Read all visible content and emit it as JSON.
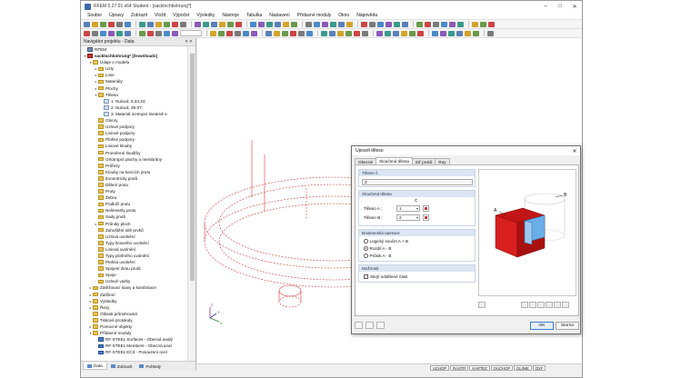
{
  "window": {
    "title": "RFEM 5.27.01 x64 Student - [sacklochbohrung*]"
  },
  "menu": [
    "Soubor",
    "Úpravy",
    "Zobrazit",
    "Vložit",
    "Výpočet",
    "Výsledky",
    "Nástroje",
    "Tabulka",
    "Nastavení",
    "Přídavné moduly",
    "Okno",
    "Nápověda"
  ],
  "navigator": {
    "title": "Navigátor projektu - Data",
    "tree": [
      {
        "level": 0,
        "expander": "",
        "icon": "proj",
        "label": "RFEM"
      },
      {
        "level": 0,
        "expander": "▾",
        "icon": "root",
        "label": "sacklochbohrung* [Downloads]",
        "bold": true
      },
      {
        "level": 1,
        "expander": "▾",
        "icon": "folder",
        "label": "Údaje o modelu"
      },
      {
        "level": 2,
        "expander": "▸",
        "icon": "folder",
        "label": "Uzly"
      },
      {
        "level": 2,
        "expander": "▸",
        "icon": "folder",
        "label": "Linie"
      },
      {
        "level": 2,
        "expander": "▸",
        "icon": "folder",
        "label": "Materiály"
      },
      {
        "level": 2,
        "expander": "▸",
        "icon": "folder",
        "label": "Plochy"
      },
      {
        "level": 2,
        "expander": "▾",
        "icon": "folder",
        "label": "Tělesa"
      },
      {
        "level": 3,
        "expander": "",
        "icon": "item",
        "label": "1: Nulová; 6,33,34;"
      },
      {
        "level": 3,
        "expander": "",
        "icon": "item",
        "label": "2: Nulová; 35-37;"
      },
      {
        "level": 3,
        "expander": "",
        "icon": "item",
        "label": "3: Materiál izotropní lineárně e"
      },
      {
        "level": 2,
        "expander": "",
        "icon": "folder",
        "label": "Otvory"
      },
      {
        "level": 2,
        "expander": "",
        "icon": "folder",
        "label": "Uzlové podpory"
      },
      {
        "level": 2,
        "expander": "",
        "icon": "folder",
        "label": "Liniové podpory"
      },
      {
        "level": 2,
        "expander": "",
        "icon": "folder",
        "label": "Plošné podpory"
      },
      {
        "level": 2,
        "expander": "",
        "icon": "folder",
        "label": "Liniové klouby"
      },
      {
        "level": 2,
        "expander": "",
        "icon": "folder",
        "label": "Proměnné tloušťky"
      },
      {
        "level": 2,
        "expander": "",
        "icon": "folder",
        "label": "Ortotropní plochy a membrány"
      },
      {
        "level": 2,
        "expander": "",
        "icon": "folder",
        "label": "Průřezy"
      },
      {
        "level": 2,
        "expander": "",
        "icon": "folder",
        "label": "Klouby na koncích prutu"
      },
      {
        "level": 2,
        "expander": "",
        "icon": "folder",
        "label": "Excentricity prutů"
      },
      {
        "level": 2,
        "expander": "",
        "icon": "folder",
        "label": "Dělení prutu"
      },
      {
        "level": 2,
        "expander": "",
        "icon": "folder",
        "label": "Pruty"
      },
      {
        "level": 2,
        "expander": "",
        "icon": "folder",
        "label": "Žebra"
      },
      {
        "level": 2,
        "expander": "",
        "icon": "folder",
        "label": "Podloží prutu"
      },
      {
        "level": 2,
        "expander": "",
        "icon": "folder",
        "label": "Nelinearity prutu"
      },
      {
        "level": 2,
        "expander": "",
        "icon": "folder",
        "label": "Sady prutů"
      },
      {
        "level": 2,
        "expander": "▸",
        "icon": "folder",
        "label": "Průniky ploch"
      },
      {
        "level": 2,
        "expander": "",
        "icon": "folder",
        "label": "Zahuštění sítě prvků"
      },
      {
        "level": 2,
        "expander": "",
        "icon": "folder",
        "label": "Uzlová uvolnění"
      },
      {
        "level": 2,
        "expander": "",
        "icon": "folder",
        "label": "Typy liniového uvolnění"
      },
      {
        "level": 2,
        "expander": "",
        "icon": "folder",
        "label": "Liniová uvolnění"
      },
      {
        "level": 2,
        "expander": "",
        "icon": "folder",
        "label": "Typy plošného uvolnění"
      },
      {
        "level": 2,
        "expander": "",
        "icon": "folder",
        "label": "Plošná uvolnění"
      },
      {
        "level": 2,
        "expander": "",
        "icon": "folder",
        "label": "Spojení dvou prutů"
      },
      {
        "level": 2,
        "expander": "",
        "icon": "folder",
        "label": "Spoje"
      },
      {
        "level": 2,
        "expander": "",
        "icon": "folder",
        "label": "Uzlové vazby"
      },
      {
        "level": 1,
        "expander": "▸",
        "icon": "folder",
        "label": "Zatěžovací stavy a kombinace"
      },
      {
        "level": 1,
        "expander": "▸",
        "icon": "folder",
        "label": "Zatížení"
      },
      {
        "level": 1,
        "expander": "▸",
        "icon": "folder",
        "label": "Výsledky"
      },
      {
        "level": 1,
        "expander": "▸",
        "icon": "folder",
        "label": "Řezy"
      },
      {
        "level": 1,
        "expander": "",
        "icon": "folder",
        "label": "Oblasti průměrování"
      },
      {
        "level": 1,
        "expander": "",
        "icon": "folder",
        "label": "Tiskové protokoly"
      },
      {
        "level": 1,
        "expander": "▸",
        "icon": "folder",
        "label": "Pomocné objekty"
      },
      {
        "level": 1,
        "expander": "▾",
        "icon": "folder",
        "label": "Přídavné moduly"
      },
      {
        "level": 2,
        "expander": "",
        "icon": "mod",
        "label": "RF-STEEL Surfaces - Obecná analý"
      },
      {
        "level": 2,
        "expander": "",
        "icon": "mod",
        "label": "RF-STEEL Members - Obecná anal"
      },
      {
        "level": 2,
        "expander": "",
        "icon": "mod",
        "label": "RF-STEEL EC3 - Posouzení ocel"
      }
    ],
    "tabs": [
      "Data",
      "Zobrazit",
      "Pohledy"
    ]
  },
  "statusbar": [
    "UCHOP",
    "RASTR",
    "KARTEZ",
    "OUCHOP",
    "GLINIE",
    "DXF"
  ],
  "dialog": {
    "title": "Upravit těleso",
    "tabs": [
      "Obecné",
      "Sloučená tělesa",
      "Síť prvků",
      "Ray"
    ],
    "active_tab": 1,
    "solid_no": {
      "header": "Těleso č.",
      "value": "3"
    },
    "merged": {
      "header": "Sloučená tělesa",
      "column_header": "Č",
      "solid_a_label": "Těleso A :",
      "solid_a_value": "1",
      "solid_b_label": "Těleso B :",
      "solid_b_value": "2"
    },
    "boolean": {
      "header": "Booleovská operace",
      "options": [
        "Logický součet A + B",
        "Rozdíl A - B",
        "Průnik A · B"
      ],
      "selected": 1
    },
    "options": {
      "header": "Možnosti",
      "hide_label": "Skrýt oddělené části",
      "hide_checked": true
    },
    "preview": {
      "label_a": "A",
      "label_b": "B",
      "solid_a_color": "#d81e1e",
      "solid_b_color": "#6aaee8"
    },
    "ok_label": "OK",
    "cancel_label": "Storno"
  },
  "model": {
    "line_color": "#d83a3a",
    "axes": [
      "X",
      "Y",
      "Z"
    ]
  }
}
